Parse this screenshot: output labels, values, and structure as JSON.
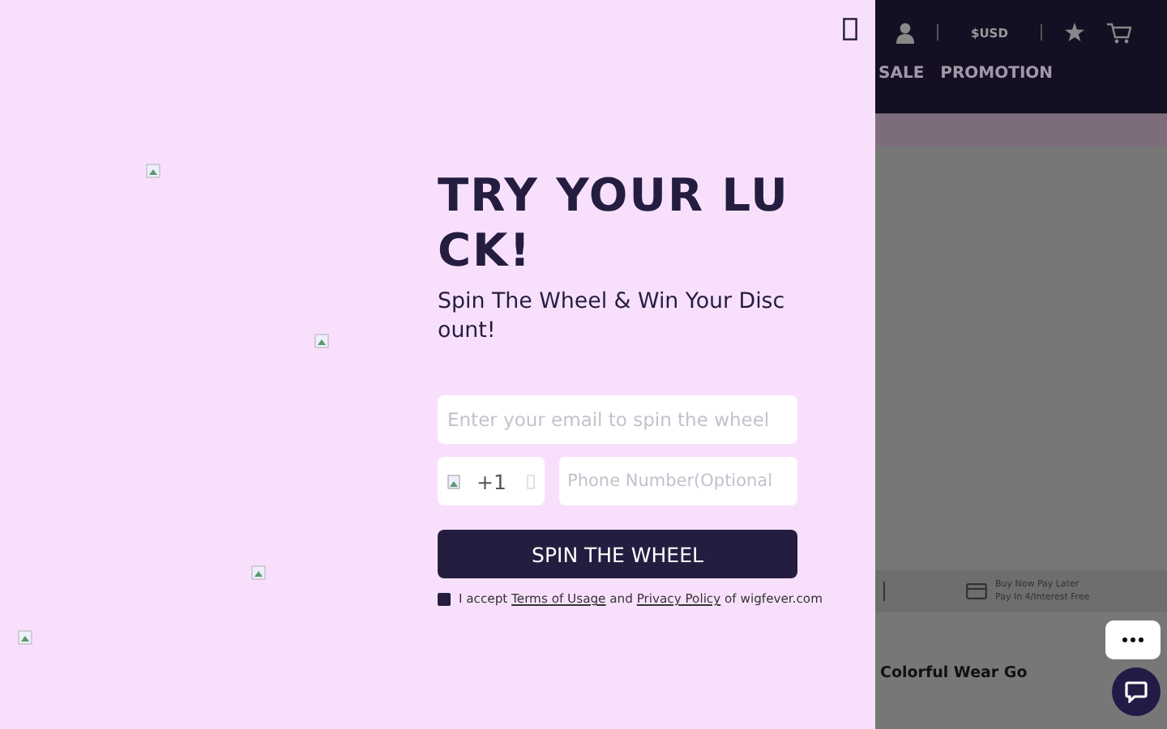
{
  "popup": {
    "title": "TRY YOUR LUCK!",
    "subtitle": "Spin The Wheel & Win Your Discount!",
    "email": {
      "placeholder": "Enter your email to spin the wheel"
    },
    "phone": {
      "code": "+1",
      "placeholder": "Phone Number(Optional"
    },
    "button": "SPIN THE WHEEL",
    "consent": {
      "checked": true,
      "parts": [
        {
          "kind": "text",
          "text": "I accept "
        },
        {
          "kind": "link",
          "text": "Terms of Usage"
        },
        {
          "kind": "text",
          "text": " and "
        },
        {
          "kind": "link",
          "text": "Privacy Policy"
        },
        {
          "kind": "text",
          "text": " of wigfever.com"
        }
      ]
    }
  },
  "header": {
    "currency": "$USD",
    "nav": [
      "SALE",
      "PROMOTION"
    ]
  },
  "banner": {
    "lines": [
      "Buy Now Pay Later",
      "Pay In 4/Interest Free"
    ]
  },
  "product_title": "Colorful Wear Go"
}
